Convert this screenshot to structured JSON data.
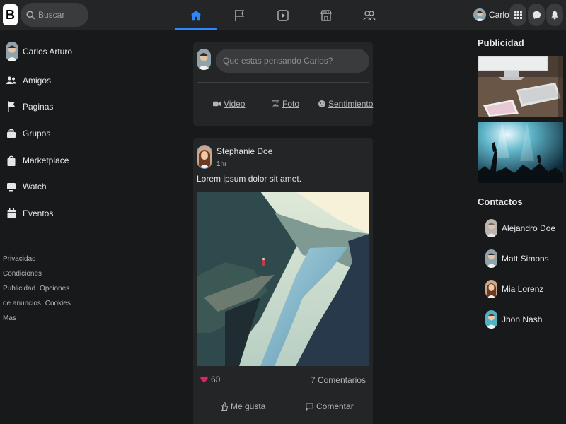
{
  "topbar": {
    "logo_letter": "B",
    "search": {
      "placeholder": "Buscar"
    },
    "tabs": [
      {
        "name": "home",
        "icon": "home-icon",
        "active": true
      },
      {
        "name": "pages",
        "icon": "flag-icon",
        "active": false
      },
      {
        "name": "watch",
        "icon": "play-icon",
        "active": false
      },
      {
        "name": "marketplace",
        "icon": "store-icon",
        "active": false
      },
      {
        "name": "groups",
        "icon": "group-icon",
        "active": false
      }
    ],
    "profile_name": "Carlos",
    "accent_color": "#2d88ff"
  },
  "sidebar": {
    "user_name": "Carlos Arturo",
    "items": [
      {
        "label": "Amigos",
        "icon": "friends-icon"
      },
      {
        "label": "Paginas",
        "icon": "flag-icon"
      },
      {
        "label": "Grupos",
        "icon": "groups-icon"
      },
      {
        "label": "Marketplace",
        "icon": "bag-icon"
      },
      {
        "label": "Watch",
        "icon": "tv-icon"
      },
      {
        "label": "Eventos",
        "icon": "calendar-icon"
      }
    ],
    "footer_links": [
      "Privacidad",
      "Condiciones",
      "Publicidad",
      "Opciones de anuncios",
      "Cookies",
      "Mas"
    ]
  },
  "composer": {
    "placeholder": "Que estas pensando Carlos?",
    "actions": [
      {
        "label": "Video",
        "icon": "video-icon"
      },
      {
        "label": "Foto",
        "icon": "photo-icon"
      },
      {
        "label": "Sentimiento",
        "icon": "smile-icon"
      }
    ]
  },
  "post": {
    "author": "Stephanie Doe",
    "time": "1hr",
    "text": "Lorem ipsum dolor sit amet.",
    "likes": "60",
    "comments": "7 Comentarios",
    "like_label": "Me gusta",
    "comment_label": "Comentar",
    "heart_color": "#e0245e"
  },
  "right": {
    "ads_title": "Publicidad",
    "contacts_title": "Contactos",
    "contacts": [
      {
        "name": "Alejandro Doe"
      },
      {
        "name": "Matt Simons"
      },
      {
        "name": "Mia Lorenz"
      },
      {
        "name": "Jhon Nash"
      }
    ]
  }
}
